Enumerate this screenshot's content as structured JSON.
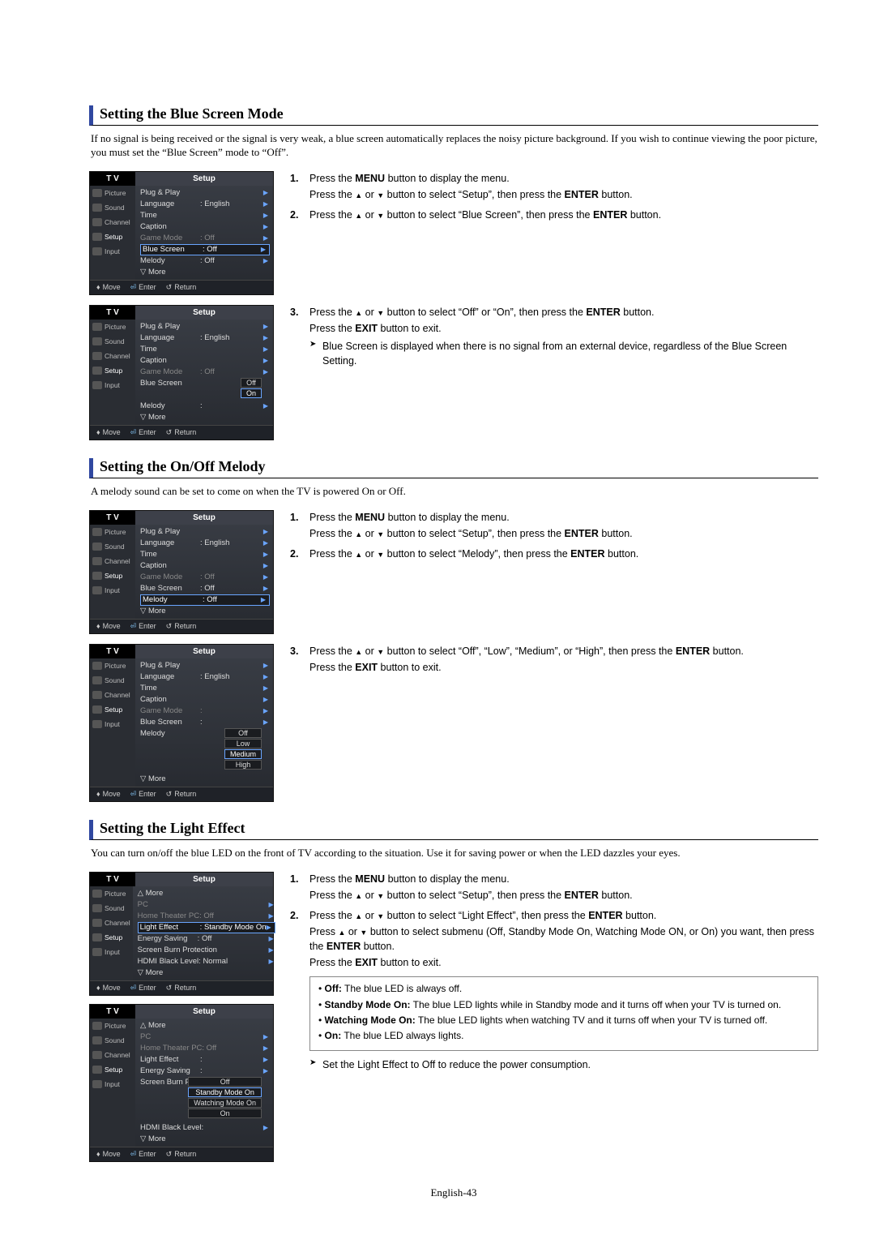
{
  "pageNumber": "English-43",
  "sections": {
    "blue": {
      "title": "Setting the Blue Screen Mode",
      "intro": "If no signal is being received or the signal is very weak, a blue screen automatically replaces the noisy picture background. If you wish to continue viewing the poor picture, you must set the “Blue Screen” mode to “Off”.",
      "steps": {
        "s1a": "Press the ",
        "s1a_bold": "MENU",
        "s1a_end": " button to display the menu.",
        "s1b_pre": "Press the ",
        "s1b_mid": " button to select “Setup”, then press the ",
        "s1b_bold": "ENTER",
        "s1b_end": " button.",
        "s2_pre": "Press the ",
        "s2_mid": " button to select “Blue Screen”, then press the ",
        "s2_bold": "ENTER",
        "s2_end": " button.",
        "s3_pre": "Press the ",
        "s3_mid": " button to select “Off” or “On”, then press the ",
        "s3_bold": "ENTER",
        "s3_end": " button.",
        "s3_exit_pre": "Press the ",
        "s3_exit_bold": "EXIT",
        "s3_exit_end": " button to exit.",
        "note": "Blue Screen is displayed when there is no signal from an external device, regardless of the Blue Screen Setting."
      }
    },
    "melody": {
      "title": "Setting the On/Off Melody",
      "intro": "A melody sound can be set to come on when the TV is powered On or Off.",
      "steps": {
        "s1a": "Press the ",
        "s1a_bold": "MENU",
        "s1a_end": " button to display the menu.",
        "s1b_pre": "Press the ",
        "s1b_mid": " button to select “Setup”, then press the ",
        "s1b_bold": "ENTER",
        "s1b_end": " button.",
        "s2_pre": "Press the ",
        "s2_mid": " button to select “Melody”, then press the ",
        "s2_bold": "ENTER",
        "s2_end": " button.",
        "s3_pre": "Press the ",
        "s3_mid": " button to select “Off”, “Low”, “Medium”, or “High”, then press the ",
        "s3_bold": "ENTER",
        "s3_end": " button.",
        "s3_exit_pre": "Press the ",
        "s3_exit_bold": "EXIT",
        "s3_exit_end": " button to exit."
      }
    },
    "light": {
      "title": "Setting the Light Effect",
      "intro": "You can turn on/off the blue LED on the front of TV according to the situation. Use it for saving power or when the LED dazzles your eyes.",
      "steps": {
        "s1a": "Press the ",
        "s1a_bold": "MENU",
        "s1a_end": " button to display the menu.",
        "s1b_pre": "Press the ",
        "s1b_mid": " button to select “Setup”, then press the ",
        "s1b_bold": "ENTER",
        "s1b_end": " button.",
        "s2_pre": "Press the ",
        "s2_mid": " button to select “Light Effect”, then press the ",
        "s2_bold": "ENTER",
        "s2_end": " button.",
        "s2b_pre": "Press ",
        "s2b_mid": " button to select submenu (Off, Standby Mode On, Watching Mode ON, or On) you want, then press the ",
        "s2b_bold": "ENTER",
        "s2b_end": " button.",
        "s2_exit_pre": "Press the ",
        "s2_exit_bold": "EXIT",
        "s2_exit_end": " button to exit."
      },
      "box": {
        "b1_label": "Off:",
        "b1_text": " The blue LED is always off.",
        "b2_label": "Standby Mode On:",
        "b2_text": " The blue LED lights while in Standby mode and it turns off when your TV is turned on.",
        "b3_label": "Watching Mode On:",
        "b3_text": " The blue LED lights when watching TV and it turns off when your TV is turned off.",
        "b4_label": "On:",
        "b4_text": " The blue LED always lights."
      },
      "note": "Set the Light Effect to Off to reduce the power consumption."
    }
  },
  "osd": {
    "tv": "T V",
    "setup": "Setup",
    "move": "Move",
    "enter": "Enter",
    "return": "Return",
    "side": [
      "Picture",
      "Sound",
      "Channel",
      "Setup",
      "Input"
    ],
    "rows_setup1": [
      {
        "label": "Plug & Play",
        "val": ""
      },
      {
        "label": "Language",
        "val": ": English"
      },
      {
        "label": "Time",
        "val": ""
      },
      {
        "label": "Caption",
        "val": ""
      },
      {
        "label": "Game Mode",
        "val": ": Off",
        "dim": true
      },
      {
        "label": "Blue Screen",
        "val": ": Off",
        "hl": true
      },
      {
        "label": "Melody",
        "val": ": Off"
      },
      {
        "label": "▽ More",
        "val": "",
        "more": true
      }
    ],
    "rows_blue_opts": [
      {
        "label": "Plug & Play",
        "val": ""
      },
      {
        "label": "Language",
        "val": ": English"
      },
      {
        "label": "Time",
        "val": ""
      },
      {
        "label": "Caption",
        "val": ""
      },
      {
        "label": "Game Mode",
        "val": ": Off",
        "dim": true
      },
      {
        "label": "Blue Screen",
        "opts": [
          "Off",
          "On"
        ],
        "sel": 1
      },
      {
        "label": "Melody",
        "val": ":"
      },
      {
        "label": "▽ More",
        "val": "",
        "more": true
      }
    ],
    "rows_melody1": [
      {
        "label": "Plug & Play",
        "val": ""
      },
      {
        "label": "Language",
        "val": ": English"
      },
      {
        "label": "Time",
        "val": ""
      },
      {
        "label": "Caption",
        "val": ""
      },
      {
        "label": "Game Mode",
        "val": ": Off",
        "dim": true
      },
      {
        "label": "Blue Screen",
        "val": ": Off"
      },
      {
        "label": "Melody",
        "val": ": Off",
        "hl": true
      },
      {
        "label": "▽ More",
        "val": "",
        "more": true
      }
    ],
    "rows_melody_opts": [
      {
        "label": "Plug & Play",
        "val": ""
      },
      {
        "label": "Language",
        "val": ": English"
      },
      {
        "label": "Time",
        "val": ""
      },
      {
        "label": "Caption",
        "val": ""
      },
      {
        "label": "Game Mode",
        "val": ":",
        "dim": true
      },
      {
        "label": "Blue Screen",
        "val": ":"
      },
      {
        "label": "Melody",
        "opts": [
          "Off",
          "Low",
          "Medium",
          "High"
        ],
        "sel": 2
      },
      {
        "label": "▽ More",
        "val": "",
        "more": true
      }
    ],
    "rows_light1": [
      {
        "label": "△ More",
        "val": "",
        "more": true
      },
      {
        "label": "PC",
        "val": "",
        "dim": true
      },
      {
        "label": "Home Theater PC",
        "val": ": Off",
        "dim": true
      },
      {
        "label": "Light Effect",
        "val": ": Standby Mode On",
        "hl": true
      },
      {
        "label": "Energy Saving",
        "val": ": Off"
      },
      {
        "label": "Screen Burn Protection",
        "val": ""
      },
      {
        "label": "HDMI Black Level",
        "val": ": Normal"
      },
      {
        "label": "▽ More",
        "val": "",
        "more": true
      }
    ],
    "rows_light_opts": [
      {
        "label": "△ More",
        "val": "",
        "more": true
      },
      {
        "label": "PC",
        "val": "",
        "dim": true
      },
      {
        "label": "Home Theater PC",
        "val": ": Off",
        "dim": true
      },
      {
        "label": "Light Effect",
        "val": ":"
      },
      {
        "label": "Energy Saving",
        "val": ":"
      },
      {
        "label": "Screen Burn Protectio",
        "opts": [
          "Off",
          "Standby Mode On",
          "Watching Mode On",
          "On"
        ],
        "sel": 1,
        "overlay": true
      },
      {
        "label": "HDMI Black Level",
        "val": ":"
      },
      {
        "label": "▽ More",
        "val": "",
        "more": true
      }
    ]
  }
}
